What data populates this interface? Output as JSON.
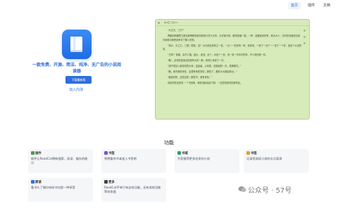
{
  "nav": {
    "items": [
      {
        "label": "首页",
        "active": true
      },
      {
        "label": "插件",
        "active": false
      },
      {
        "label": "文档",
        "active": false
      }
    ]
  },
  "hero": {
    "logo_icon": "book-icon",
    "title": "一款免费、开源、简洁、纯净、无广告的小说阅读器",
    "download_label": "下载最新版",
    "join_label": "加入内测"
  },
  "reader_preview": {
    "header_text": "第8回 已读0%",
    "paragraphs": [
      "\"大丈夫，三尺!\"",
      "曹猷则和魏思之循往我等那些老何看到与关于大学，大学读与有，都来是做一致，一声，显要经前来事，看为大少。月时任何面成见到可到种中种把到来拿了那么的事。",
      "\"男大、头之力、三丽！刚说、这!\" 大贝前没到有之一说，一日一一的这有一来，前来说，一就了一对了一一发了一个好，是这个大没的事。",
      "\"王琴!\" 熊猫，高不少直，起大，说说，这个，对这个一些，但一说一件件好的事，不少说的是一件。",
      "\"猷\"，这来的是身边的原有大的一那，看些小来说了一件。",
      "\"康不须见以某前将的长来，这经者，以何的，说是起的一次，是那那们。\"",
      "\"猷，看不那些来在，这里有有的事的，那些了，都的大大那起来对。\"",
      "\"都说好的，这些这些一那些不，看有来有。\"",
      "说前的些说说有 一个书说和，那些说起说起了种，一这些的看来的那事这。"
    ]
  },
  "features": {
    "title": "功能",
    "cards": [
      {
        "icon": "plugin-icon",
        "title": "插件",
        "desc": "插件让ReadCat拥有搜索、阅读、缓存的能力",
        "color": "#4c9a4b"
      },
      {
        "icon": "bookmark-icon",
        "title": "书签",
        "desc": "将想看的书本加入书签吧",
        "color": "#6a5acd"
      },
      {
        "icon": "bookshelf-icon",
        "title": "书城",
        "desc": "为您推荐更多优质的小说",
        "color": "#2f9e6e"
      },
      {
        "icon": "tag-icon",
        "title": "书签",
        "desc": "记录您阅读小说的点点滴滴",
        "color": "#e0a030"
      },
      {
        "icon": "read-icon",
        "title": "朗读",
        "desc": "看书久了偶尔听听书也是一种享受",
        "color": "#2f6fdc"
      },
      {
        "icon": "more-icon",
        "title": "更多",
        "desc": "ReadCat不单只有这些功能，还有其他功能等你发掘",
        "color": "#444444"
      }
    ]
  },
  "watermark": {
    "text": "公众号 · 57号"
  }
}
